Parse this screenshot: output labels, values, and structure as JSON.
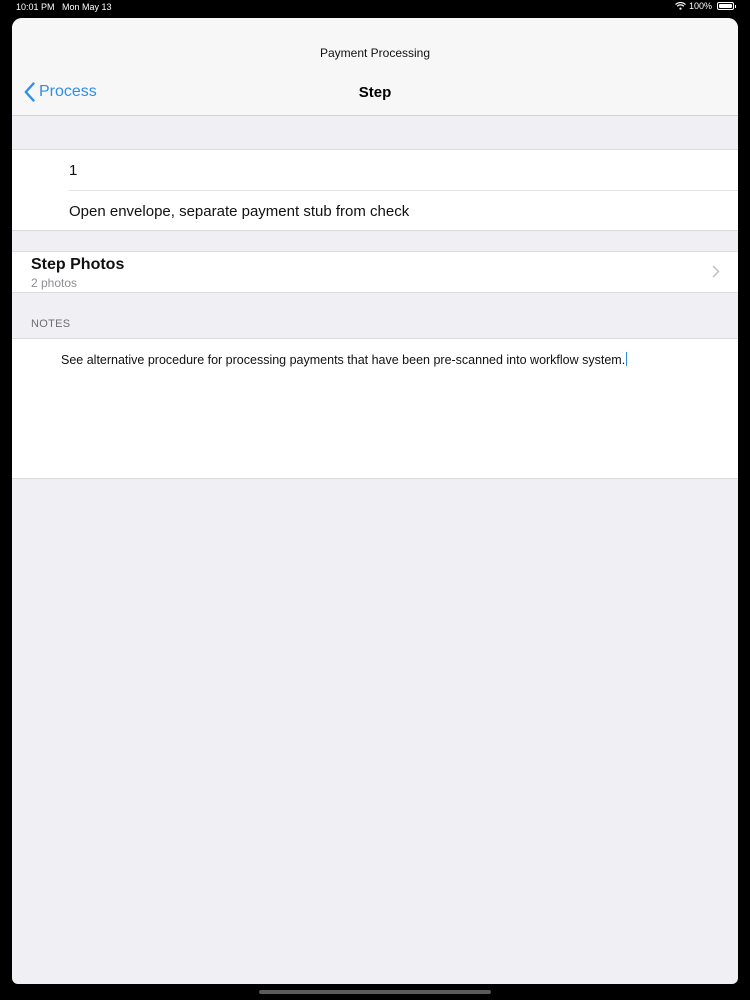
{
  "status_bar": {
    "time": "10:01 PM",
    "date": "Mon May 13",
    "battery": "100%",
    "icons": [
      "wifi-icon",
      "battery-icon"
    ]
  },
  "nav": {
    "subtitle": "Payment Processing",
    "title": "Step",
    "back_label": "Process",
    "back_icon": "chevron-left-icon",
    "accent_color": "#2f8fe8"
  },
  "step": {
    "number": "1",
    "description": "Open envelope, separate payment stub from check"
  },
  "photos": {
    "title": "Step Photos",
    "count": "2 photos",
    "icon": "chevron-right-icon"
  },
  "notes": {
    "header": "NOTES",
    "text": "See alternative procedure for processing payments that have been pre-scanned into workflow system."
  }
}
